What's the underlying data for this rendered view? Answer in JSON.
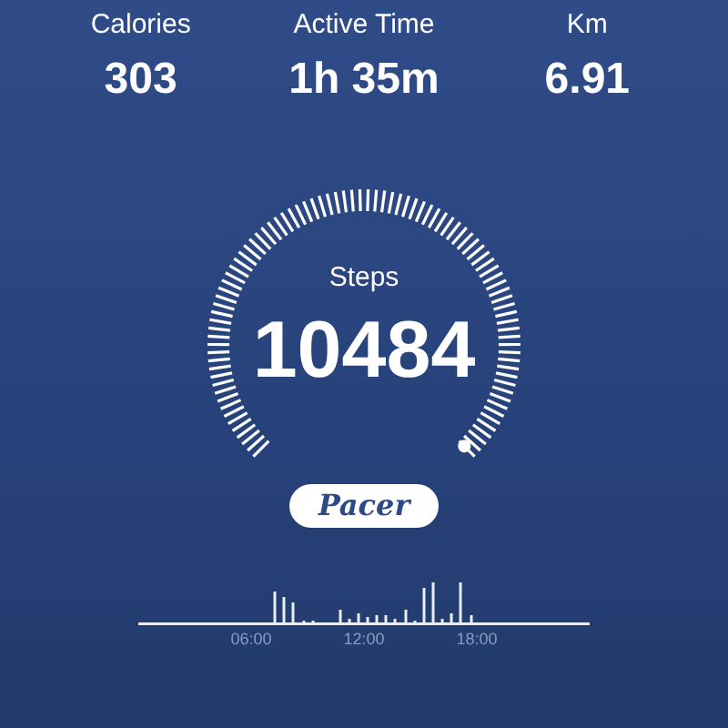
{
  "stats": [
    {
      "label": "Calories",
      "value": "303"
    },
    {
      "label": "Active Time",
      "value": "1h 35m"
    },
    {
      "label": "Km",
      "value": "6.91"
    }
  ],
  "gauge": {
    "label": "Steps",
    "value": "10484"
  },
  "logo": {
    "text": "Pacer"
  },
  "timeline": {
    "labels": [
      "06:00",
      "12:00",
      "18:00"
    ]
  }
}
